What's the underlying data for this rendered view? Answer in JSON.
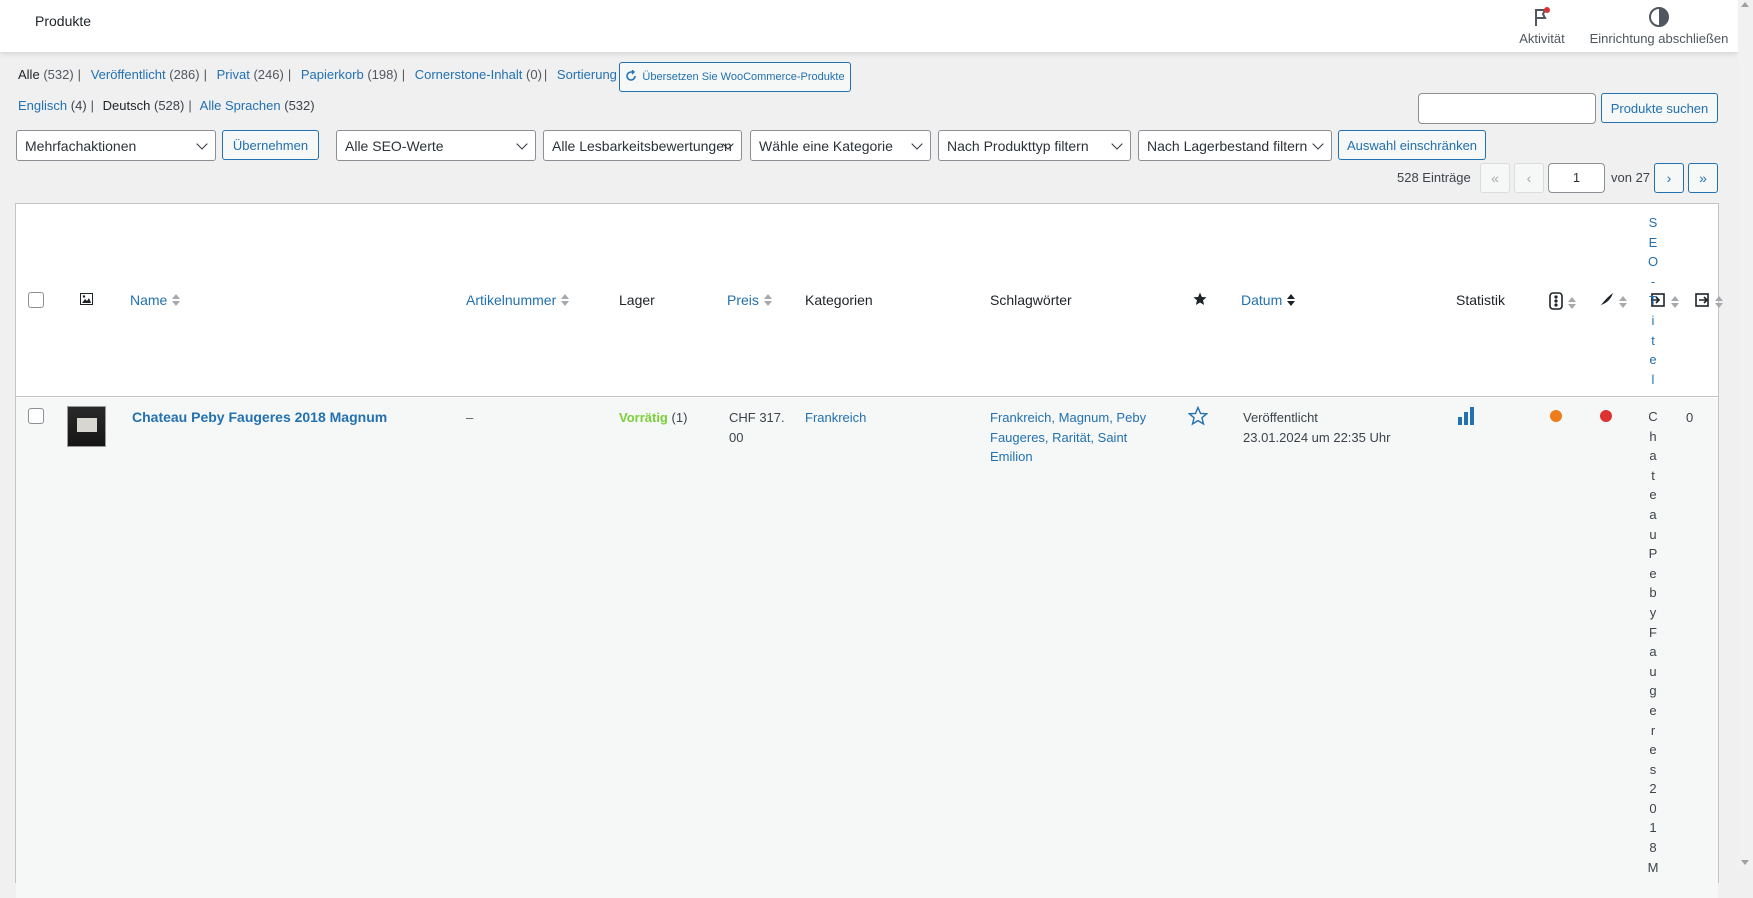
{
  "header": {
    "title": "Produkte",
    "activity_label": "Aktivität",
    "setup_label": "Einrichtung abschließen"
  },
  "status_filters": [
    {
      "label": "Alle",
      "count": "(532)"
    },
    {
      "label": "Veröffentlicht",
      "count": "(286)"
    },
    {
      "label": "Privat",
      "count": "(246)"
    },
    {
      "label": "Papierkorb",
      "count": "(198)"
    },
    {
      "label": "Cornerstone-Inhalt",
      "count": "(0)"
    },
    {
      "label": "Sortierung",
      "count": ""
    }
  ],
  "translate_button": "Übersetzen Sie WooCommerce-Produkte",
  "languages": [
    {
      "label": "Englisch",
      "count": "(4)"
    },
    {
      "label": "Deutsch",
      "count": "(528)"
    },
    {
      "label": "Alle Sprachen",
      "count": "(532)"
    }
  ],
  "search": {
    "value": "",
    "button": "Produkte suchen"
  },
  "filters": {
    "bulk_action": "Mehrfachaktionen",
    "apply_button": "Übernehmen",
    "seo": "Alle SEO-Werte",
    "readability": "Alle Lesbarkeitsbewertungen",
    "category": "Wähle eine Kategorie",
    "product_type": "Nach Produkttyp filtern",
    "stock": "Nach Lagerbestand filtern",
    "filter_button": "Auswahl einschränken"
  },
  "pagination": {
    "count": "528 Einträge",
    "first": "«",
    "prev": "‹",
    "current": "1",
    "of": "von 27",
    "next": "›",
    "last": "»"
  },
  "columns": {
    "name": "Name",
    "sku": "Artikelnummer",
    "stock": "Lager",
    "price": "Preis",
    "categories": "Kategorien",
    "tags": "Schlagwörter",
    "date": "Datum",
    "stats": "Statistik",
    "seo_title": "SEO-Titel"
  },
  "rows": [
    {
      "name": "Chateau Peby Faugeres 2018 Magnum",
      "sku": "–",
      "stock_status": "Vorrätig",
      "stock_qty": "(1)",
      "price_line1": "CHF 317.",
      "price_line2": "00",
      "category": "Frankreich",
      "tags_line1": "Frankreich, Magnum, Peby",
      "tags_line2": "Faugeres, Rarität, Saint",
      "tags_line3": "Emilion",
      "date_status": "Veröffentlicht",
      "date_value": "23.01.2024 um 22:35 Uhr",
      "seo_title": "Chateau Peby Faugeres 2018 M",
      "links_count": "0"
    }
  ],
  "colors": {
    "accent": "#2271b1",
    "in_stock": "#00a32a",
    "seo_orange": "#ee7c1b",
    "readability_red": "#dc3232"
  }
}
